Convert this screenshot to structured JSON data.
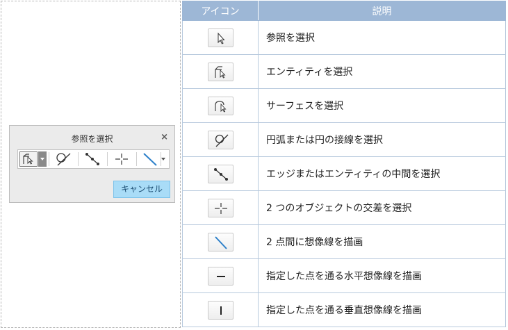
{
  "dialog": {
    "title": "参照を選択",
    "close_symbol": "×",
    "cancel_label": "キャンセル",
    "toolbar_icons": [
      "select-entity-icon",
      "arc-tangent-icon",
      "edge-midpoint-icon",
      "intersection-icon",
      "imaginary-line-icon"
    ]
  },
  "table": {
    "headers": {
      "icon": "アイコン",
      "description": "説明"
    },
    "rows": [
      {
        "icon": "arrow-cursor-icon",
        "description": "参照を選択"
      },
      {
        "icon": "select-entity-icon",
        "description": "エンティティを選択"
      },
      {
        "icon": "select-surface-icon",
        "description": "サーフェスを選択"
      },
      {
        "icon": "arc-tangent-icon",
        "description": "円弧または円の接線を選択"
      },
      {
        "icon": "edge-midpoint-icon",
        "description": "エッジまたはエンティティの中間を選択"
      },
      {
        "icon": "intersection-icon",
        "description": "2 つのオブジェクトの交差を選択"
      },
      {
        "icon": "imaginary-line-icon",
        "description": "2 点間に想像線を描画"
      },
      {
        "icon": "horizontal-line-icon",
        "description": "指定した点を通る水平想像線を描画"
      },
      {
        "icon": "vertical-line-icon",
        "description": "指定した点を通る垂直想像線を描画"
      }
    ]
  },
  "colors": {
    "header_bg": "#9db7d6",
    "accent_line": "#2b7fc9",
    "cancel_bg": "#a9dcf7"
  }
}
